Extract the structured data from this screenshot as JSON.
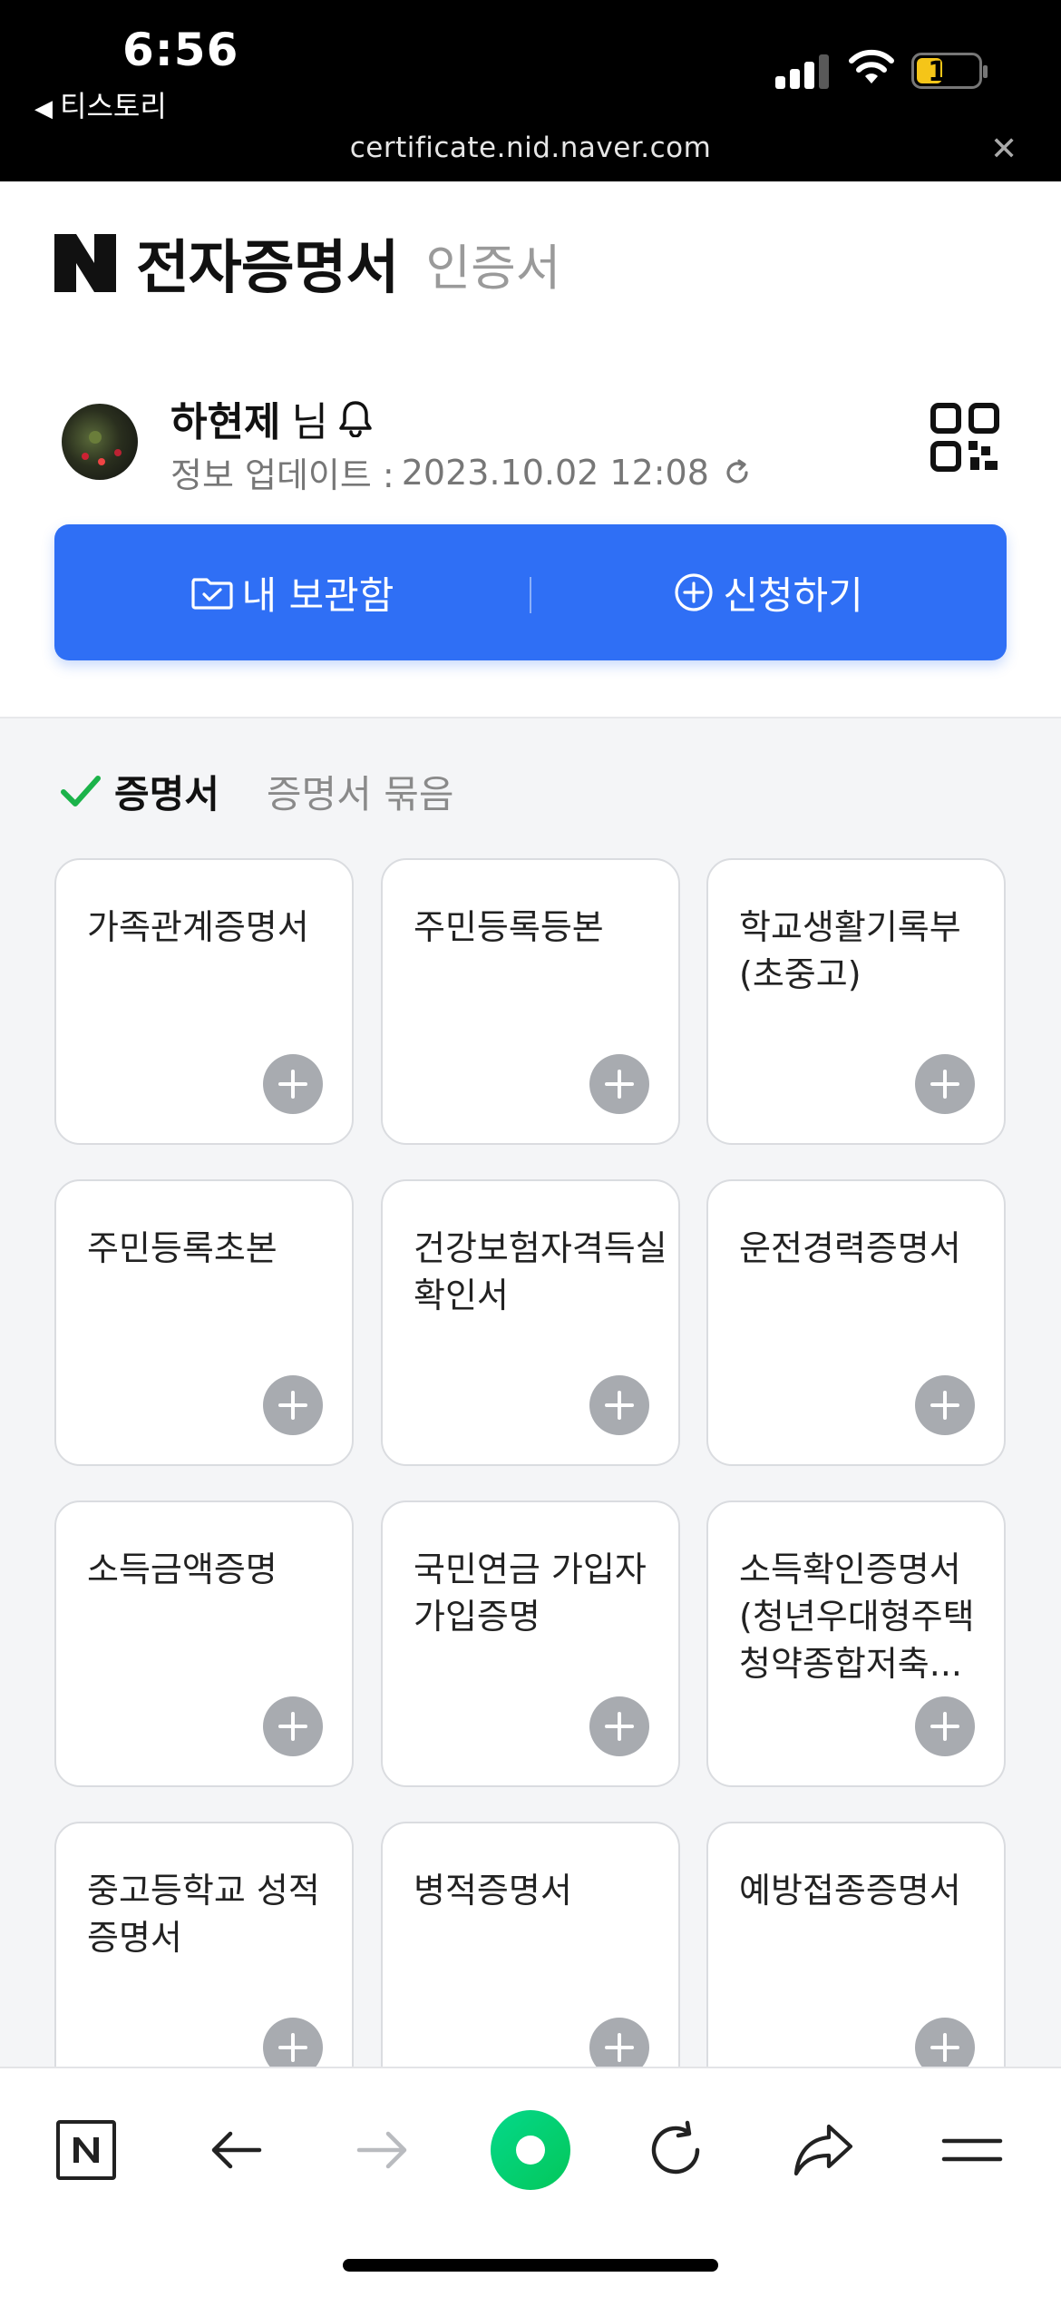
{
  "status_bar": {
    "time": "6:56",
    "back_app": "티스토리",
    "battery": "15",
    "url": "certificate.nid.naver.com",
    "close_symbol": "✕"
  },
  "header": {
    "logo_letter": "N",
    "title": "전자증명서",
    "subtitle": "인증서"
  },
  "profile": {
    "name": "하현제",
    "honorific": "님",
    "update_label": "정보 업데이트 :",
    "update_value": "2023.10.02 12:08"
  },
  "actions": {
    "left_label": "내 보관함",
    "right_label": "신청하기"
  },
  "tabs": {
    "active": "증명서",
    "inactive": "증명서 묶음"
  },
  "cards": [
    {
      "title": "가족관계증명서"
    },
    {
      "title": "주민등록등본"
    },
    {
      "title": "학교생활기록부(초중고)"
    },
    {
      "title": "주민등록초본"
    },
    {
      "title": "건강보험자격득실확인서"
    },
    {
      "title": "운전경력증명서"
    },
    {
      "title": "소득금액증명"
    },
    {
      "title": "국민연금 가입자 가입증명"
    },
    {
      "title": "소득확인증명서(청년우대형주택청약종합저축..."
    },
    {
      "title": "중고등학교 성적증명서"
    },
    {
      "title": "병적증명서"
    },
    {
      "title": "예방접종증명서"
    }
  ],
  "colors": {
    "accent_blue": "#2f6ff5",
    "check_green": "#1bb34a",
    "naver_green": "#03c75a"
  },
  "icons": {
    "toolbar": [
      "naver-n-icon",
      "back-arrow-icon",
      "forward-arrow-icon",
      "green-dot-icon",
      "reload-icon",
      "share-icon",
      "menu-icon"
    ]
  }
}
